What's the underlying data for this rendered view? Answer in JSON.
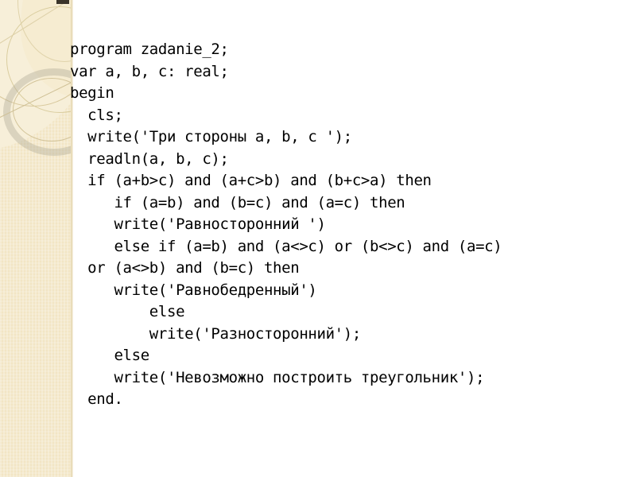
{
  "slide": {
    "background_color": "#ffffff",
    "sidebar_color": "#f2e5c4",
    "text_color": "#000000"
  },
  "code": {
    "language": "pascal",
    "lines": [
      "program zadanie_2;",
      "var a, b, c: real;",
      "begin",
      "  cls;",
      "  write('Три стороны a, b, c ');",
      "  readln(a, b, c);",
      "  if (a+b>c) and (a+c>b) and (b+c>a) then",
      "     if (a=b) and (b=c) and (a=c) then",
      "     write('Равносторонний ')",
      "     else if (a=b) and (a<>c) or (b<>c) and (a=c)",
      "  or (a<>b) and (b=c) then",
      "     write('Равнобедренный')",
      "         else",
      "         write('Разносторонний');",
      "     else",
      "     write('Невозможно построить треугольник');",
      "  end."
    ]
  }
}
